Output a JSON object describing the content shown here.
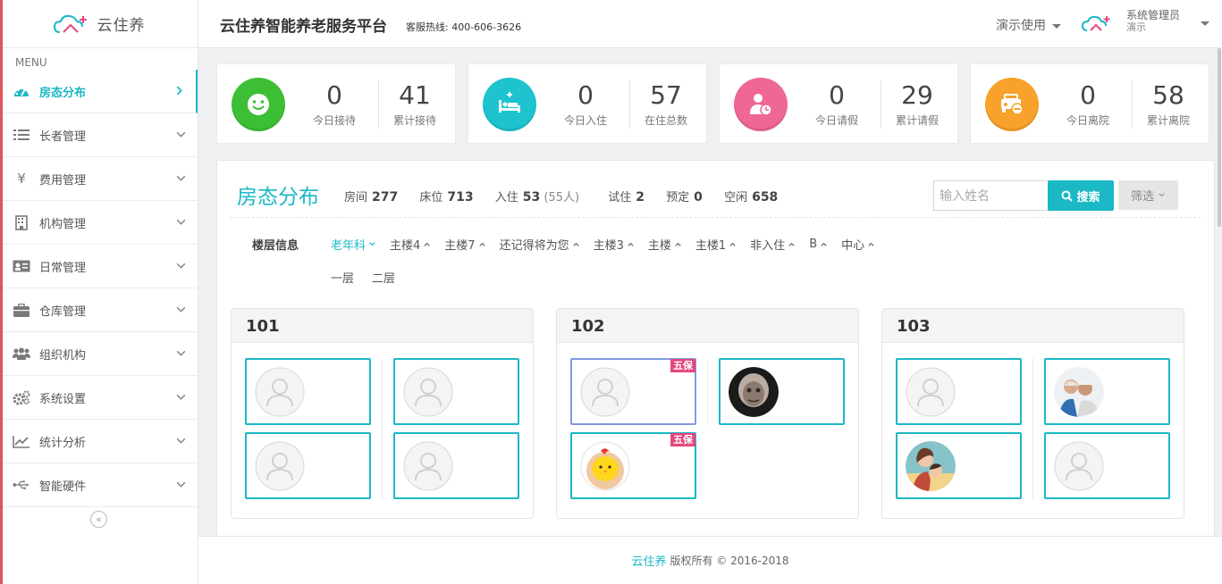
{
  "logo": {
    "text": "云住养",
    "icon": "cloud-house-icon"
  },
  "sidebar": {
    "menu_label": "MENU",
    "items": [
      {
        "label": "房态分布",
        "icon": "dashboard-icon",
        "active": true
      },
      {
        "label": "长者管理",
        "icon": "list-icon"
      },
      {
        "label": "费用管理",
        "icon": "yen-icon"
      },
      {
        "label": "机构管理",
        "icon": "building-icon"
      },
      {
        "label": "日常管理",
        "icon": "id-card-icon"
      },
      {
        "label": "仓库管理",
        "icon": "briefcase-icon"
      },
      {
        "label": "组织机构",
        "icon": "users-icon"
      },
      {
        "label": "系统设置",
        "icon": "gears-icon"
      },
      {
        "label": "统计分析",
        "icon": "line-chart-icon"
      },
      {
        "label": "智能硬件",
        "icon": "usb-icon"
      }
    ],
    "collapse_icon": "double-chevron-left-icon",
    "collapse_text": "«"
  },
  "header": {
    "title": "云住养智能养老服务平台",
    "hotline": "客服热线: 400-606-3626",
    "demo_label": "演示使用",
    "user_name": "系统管理员",
    "user_role": "演示"
  },
  "stats": [
    {
      "icon": "smile-icon",
      "color": "#3cbf35",
      "today": "0",
      "today_label": "今日接待",
      "total": "41",
      "total_label": "累计接待"
    },
    {
      "icon": "bed-plus-icon",
      "color": "#1ec3cf",
      "today": "0",
      "today_label": "今日入住",
      "total": "57",
      "total_label": "在住总数"
    },
    {
      "icon": "person-clock-icon",
      "color": "#ef6794",
      "today": "0",
      "today_label": "今日请假",
      "total": "29",
      "total_label": "累计请假"
    },
    {
      "icon": "car-minus-icon",
      "color": "#f7a22b",
      "today": "0",
      "today_label": "今日离院",
      "total": "58",
      "total_label": "累计离院"
    }
  ],
  "panel": {
    "title": "房态分布",
    "rooms_label": "房间",
    "rooms": "277",
    "beds_label": "床位",
    "beds": "713",
    "checkin_label": "入住",
    "checkin": "53",
    "checkin_people": "(55人)",
    "trial_label": "试住",
    "trial": "2",
    "reserved_label": "预定",
    "reserved": "0",
    "free_label": "空闲",
    "free": "658",
    "search_placeholder": "输入姓名",
    "search_button": "搜索",
    "filter_button": "筛选"
  },
  "floors": {
    "label": "楼层信息",
    "buildings": [
      "老年科",
      "主楼4",
      "主楼7",
      "还记得将为您",
      "主楼3",
      "主楼",
      "主楼1",
      "非入住",
      "B",
      "中心"
    ],
    "selected": "老年科",
    "levels": [
      "一层",
      "二层"
    ]
  },
  "rooms": [
    {
      "number": "101",
      "beds": [
        {
          "avatar": "default-avatar-icon"
        },
        {
          "avatar": "default-avatar-icon"
        },
        {
          "avatar": "default-avatar-icon"
        },
        {
          "avatar": "default-avatar-icon"
        }
      ]
    },
    {
      "number": "102",
      "beds": [
        {
          "avatar": "default-avatar-icon",
          "tag": "五保"
        },
        {
          "avatar": "elderly-woman-photo"
        },
        {
          "avatar": "cartoon-chick-avatar",
          "tag": "五保"
        }
      ]
    },
    {
      "number": "103",
      "beds": [
        {
          "avatar": "default-avatar-icon"
        },
        {
          "avatar": "elderly-couple-photo"
        },
        {
          "avatar": "mother-child-illustration"
        },
        {
          "avatar": "default-avatar-icon"
        }
      ]
    }
  ],
  "footer": {
    "brand": "云住养",
    "copyright": "版权所有 © 2016-2018"
  },
  "colors": {
    "accent": "#1bb8c6",
    "tag": "#e5467e",
    "bed_border": "#1bb8c6",
    "bed_border_selected": "#7f9be0"
  }
}
